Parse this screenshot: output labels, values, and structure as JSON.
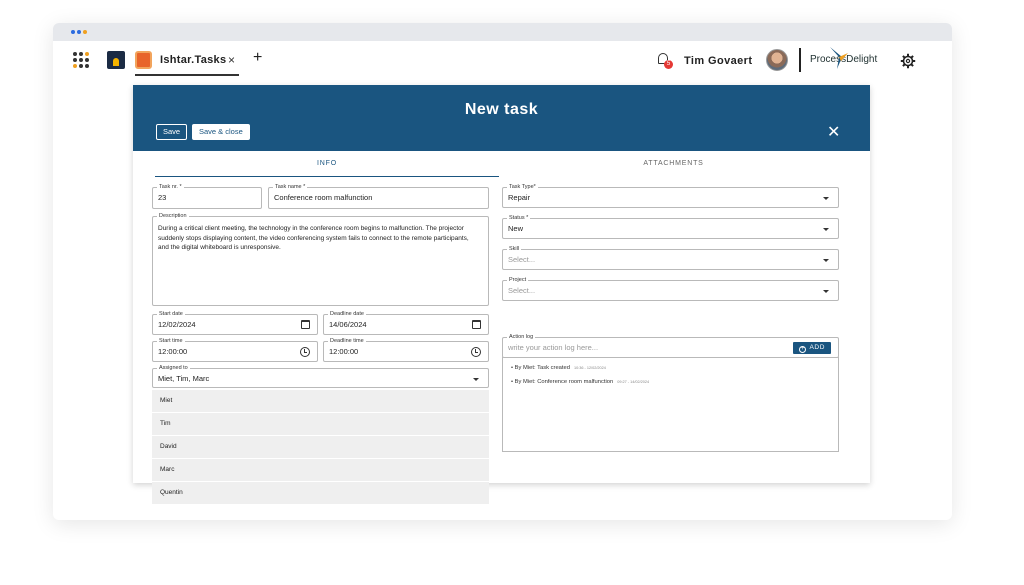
{
  "app": {
    "name": "Ishtar.Tasks",
    "close_glyph": "×",
    "add_tab_glyph": "+"
  },
  "header": {
    "notification_count": "5",
    "user_name": "Tim Govaert",
    "brand_name": "ProcessDelight",
    "brand_part1": "Process",
    "brand_part2": "Delight"
  },
  "modal": {
    "title": "New task",
    "save_label": "Save",
    "save_close_label": "Save & close",
    "close_glyph": "✕",
    "tabs": [
      {
        "label": "INFO",
        "active": true
      },
      {
        "label": "ATTACHMENTS",
        "active": false
      }
    ]
  },
  "form": {
    "task_nr": {
      "label": "Task nr. *",
      "value": "23"
    },
    "task_name": {
      "label": "Task name *",
      "value": "Conference room malfunction"
    },
    "description": {
      "label": "Description",
      "value": "During a critical client meeting, the technology in the conference room begins to malfunction. The projector suddenly stops displaying content, the video conferencing system fails to connect to the remote participants, and the digital whiteboard is unresponsive."
    },
    "start_date": {
      "label": "Start date",
      "value": "12/02/2024"
    },
    "deadline_date": {
      "label": "Deadline date",
      "value": "14/06/2024"
    },
    "start_time": {
      "label": "Start time",
      "value": "12:00:00"
    },
    "deadline_time": {
      "label": "Deadline time",
      "value": "12:00:00"
    },
    "assigned_to": {
      "label": "Assigned to",
      "value": "Miet, Tim, Marc",
      "options": [
        "Miet",
        "Tim",
        "David",
        "Marc",
        "Quentin"
      ]
    },
    "task_type": {
      "label": "Task Type*",
      "value": "Repair"
    },
    "status": {
      "label": "Status *",
      "value": "New"
    },
    "skill": {
      "label": "Skill",
      "placeholder": "Select..."
    },
    "project": {
      "label": "Project",
      "placeholder": "Select..."
    },
    "action_log": {
      "label": "Action log",
      "placeholder": "write your action log here...",
      "add_label": "ADD",
      "entries": [
        {
          "text": "By Miet: Task created",
          "time": "10:36 - 12/02/2024"
        },
        {
          "text": "By Miet: Conference room malfunction",
          "time": "09:27 - 14/02/2024"
        }
      ]
    }
  },
  "colors": {
    "header_blue": "#1a5580",
    "accent_orange": "#e8642a",
    "badge_red": "#e53935"
  },
  "icons": [
    "apps-grid-icon",
    "home-icon",
    "bell-icon",
    "gear-icon",
    "calendar-icon",
    "clock-icon",
    "chevron-down-icon",
    "add-circle-icon"
  ]
}
